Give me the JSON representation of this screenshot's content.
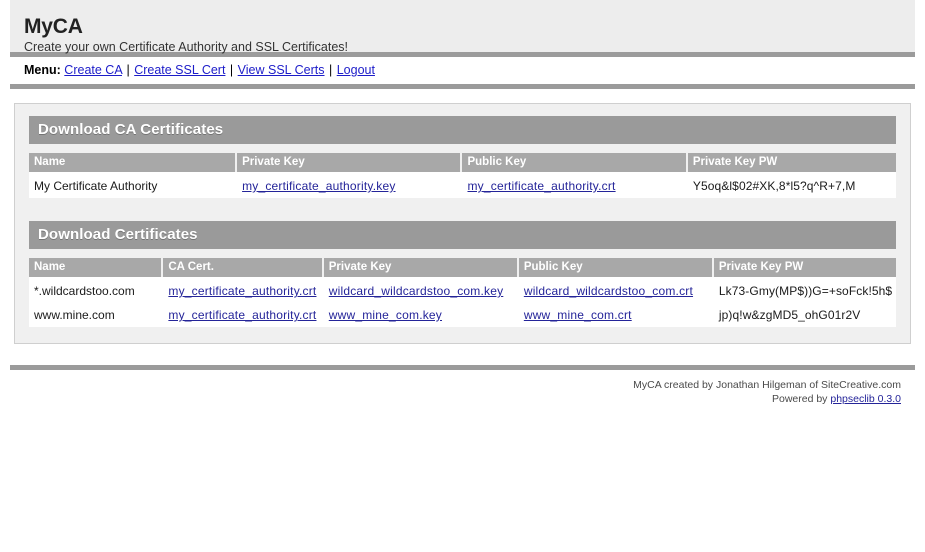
{
  "header": {
    "title": "MyCA",
    "tagline": "Create your own Certificate Authority and SSL Certificates!"
  },
  "menu": {
    "label": "Menu:",
    "separator": "|",
    "items": [
      {
        "label": "Create CA"
      },
      {
        "label": "Create SSL Cert"
      },
      {
        "label": "View SSL Certs"
      },
      {
        "label": "Logout"
      }
    ]
  },
  "ca_section": {
    "title": "Download CA Certificates",
    "columns": [
      "Name",
      "Private Key",
      "Public Key",
      "Private Key PW"
    ],
    "rows": [
      {
        "name": "My Certificate Authority",
        "private_key": "my_certificate_authority.key",
        "public_key": "my_certificate_authority.crt",
        "private_key_pw": "Y5oq&l$02#XK,8*l5?q^R+7,M"
      }
    ]
  },
  "certs_section": {
    "title": "Download Certificates",
    "columns": [
      "Name",
      "CA Cert.",
      "Private Key",
      "Public Key",
      "Private Key PW"
    ],
    "rows": [
      {
        "name": "*.wildcardstoo.com",
        "ca_cert": "my_certificate_authority.crt",
        "private_key": "wildcard_wildcardstoo_com.key",
        "public_key": "wildcard_wildcardstoo_com.crt",
        "private_key_pw": "Lk73-Gmy(MP$))G=+soFck!5h$"
      },
      {
        "name": "www.mine.com",
        "ca_cert": "my_certificate_authority.crt",
        "private_key": "www_mine_com.key",
        "public_key": "www_mine_com.crt",
        "private_key_pw": "jp)q!w&zgMD5_ohG01r2V"
      }
    ]
  },
  "footer": {
    "credit": "MyCA created by Jonathan Hilgeman of SiteCreative.com",
    "powered_prefix": "Powered by ",
    "powered_link": "phpseclib 0.3.0"
  },
  "colors": {
    "header_bg": "#ededed",
    "rule": "#9b9b9b",
    "section_title_bg": "#9a9a9a",
    "table_header_bg": "#a8a8a8",
    "panel_bg": "#f0f0f0",
    "link": "#242499",
    "menu_link": "#1c1cc9"
  }
}
